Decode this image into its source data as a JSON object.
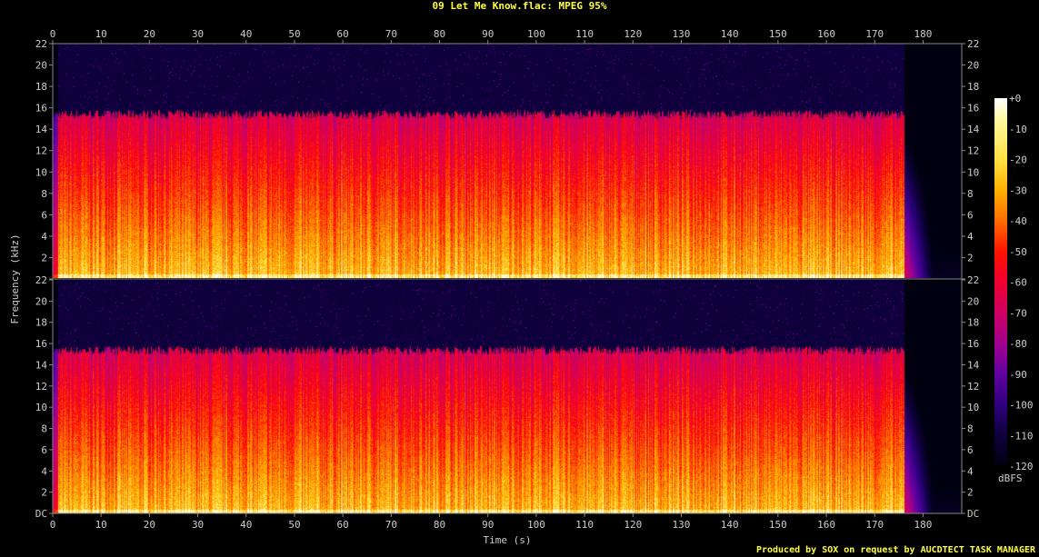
{
  "title": "09 Let Me Know.flac: MPEG 95%",
  "footer": "Produced by SOX on request by AUCDTECT TASK MANAGER",
  "colors": {
    "title": "#ffff40",
    "axis": "#cccccc",
    "background": "#000000"
  },
  "chart_data": {
    "type": "heatmap",
    "title": "09 Let Me Know.flac: MPEG 95%",
    "xlabel": "Time (s)",
    "ylabel": "Frequency (kHz)",
    "xlim": [
      0,
      188
    ],
    "ylim": [
      0,
      22
    ],
    "x_ticks": [
      "0",
      "10",
      "20",
      "30",
      "40",
      "50",
      "60",
      "70",
      "80",
      "90",
      "100",
      "110",
      "120",
      "130",
      "140",
      "150",
      "160",
      "170",
      "180"
    ],
    "y_ticks": [
      "DC",
      "2",
      "4",
      "6",
      "8",
      "10",
      "12",
      "14",
      "16",
      "18",
      "20",
      "22"
    ],
    "channels": 2,
    "lowpass_cutoff_khz": 16,
    "audio_end_s": 180,
    "colorbar": {
      "label": "dBFS",
      "ticks": [
        "+0",
        "-10",
        "-20",
        "-30",
        "-40",
        "-50",
        "-60",
        "-70",
        "-80",
        "-90",
        "-100",
        "-110",
        "-120"
      ],
      "range": [
        -120,
        0
      ]
    }
  }
}
